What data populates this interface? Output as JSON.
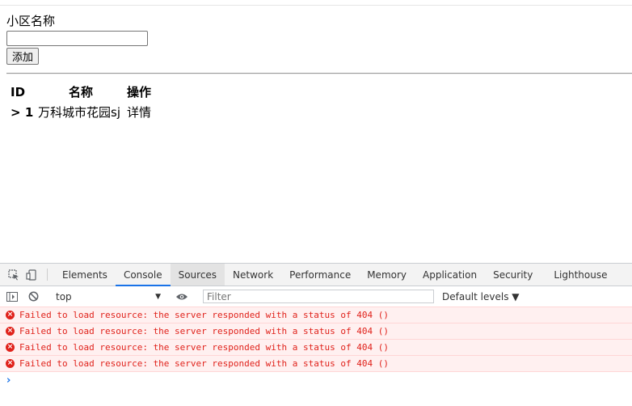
{
  "form": {
    "label": "小区名称",
    "input_value": "",
    "add_button": "添加"
  },
  "table": {
    "headers": [
      "ID",
      "名称",
      "操作"
    ],
    "rows": [
      {
        "arrow": ">",
        "id": "1",
        "name": "万科城市花园sj",
        "action": "详情"
      }
    ]
  },
  "devtools": {
    "tabs": [
      "Elements",
      "Console",
      "Sources",
      "Network",
      "Performance",
      "Memory",
      "Application",
      "Security",
      "Lighthouse"
    ],
    "active_tab": "Console",
    "context": "top",
    "filter_placeholder": "Filter",
    "levels": "Default levels ▼",
    "messages": [
      "Failed to load resource: the server responded with a status of 404 ()",
      "Failed to load resource: the server responded with a status of 404 ()",
      "Failed to load resource: the server responded with a status of 404 ()",
      "Failed to load resource: the server responded with a status of 404 ()"
    ],
    "prompt": "›"
  },
  "colors": {
    "accent": "#1a73e8",
    "error": "#e0221b",
    "error_bg": "#fff0f0"
  }
}
